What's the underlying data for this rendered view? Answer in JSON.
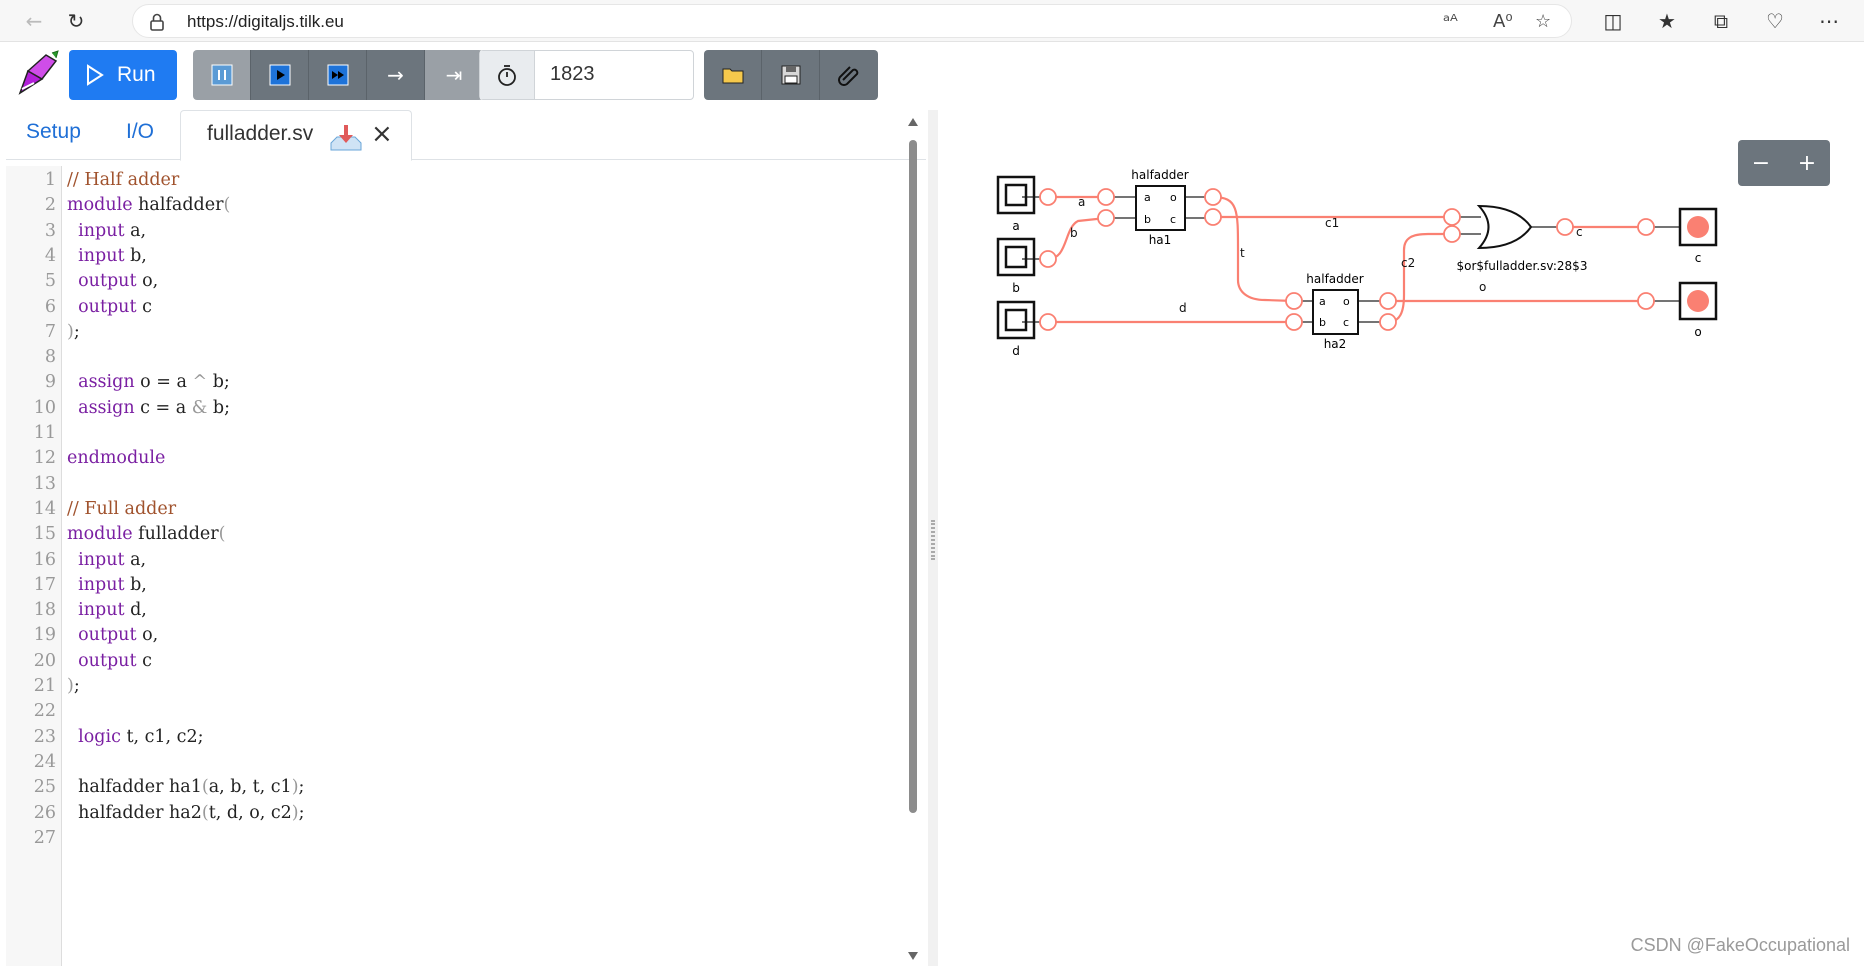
{
  "browser": {
    "url": "https://digitaljs.tilk.eu"
  },
  "toolbar": {
    "run_label": "Run",
    "tick_value": "1823"
  },
  "tabs": {
    "setup": "Setup",
    "io": "I/O",
    "file": "fulladder.sv"
  },
  "code_lines": [
    {
      "n": "1",
      "html": "<span class=\"cm\">// Half adder</span>"
    },
    {
      "n": "2",
      "html": "<span class=\"kw\">module</span> halfadder<span class=\"pn\">(</span>"
    },
    {
      "n": "3",
      "html": "  <span class=\"kw\">input</span> a,"
    },
    {
      "n": "4",
      "html": "  <span class=\"kw\">input</span> b,"
    },
    {
      "n": "5",
      "html": "  <span class=\"kw\">output</span> o,"
    },
    {
      "n": "6",
      "html": "  <span class=\"kw\">output</span> c"
    },
    {
      "n": "7",
      "html": "<span class=\"pn\">)</span>;"
    },
    {
      "n": "8",
      "html": ""
    },
    {
      "n": "9",
      "html": "  <span class=\"kw\">assign</span> o = a <span class=\"pn\">^</span> b;"
    },
    {
      "n": "10",
      "html": "  <span class=\"kw\">assign</span> c = a <span class=\"pn\">&amp;</span> b;"
    },
    {
      "n": "11",
      "html": ""
    },
    {
      "n": "12",
      "html": "<span class=\"kw\">endmodule</span>"
    },
    {
      "n": "13",
      "html": ""
    },
    {
      "n": "14",
      "html": "<span class=\"cm\">// Full adder</span>"
    },
    {
      "n": "15",
      "html": "<span class=\"kw\">module</span> fulladder<span class=\"pn\">(</span>"
    },
    {
      "n": "16",
      "html": "  <span class=\"kw\">input</span> a,"
    },
    {
      "n": "17",
      "html": "  <span class=\"kw\">input</span> b,"
    },
    {
      "n": "18",
      "html": "  <span class=\"kw\">input</span> d,"
    },
    {
      "n": "19",
      "html": "  <span class=\"kw\">output</span> o,"
    },
    {
      "n": "20",
      "html": "  <span class=\"kw\">output</span> c"
    },
    {
      "n": "21",
      "html": "<span class=\"pn\">)</span>;"
    },
    {
      "n": "22",
      "html": ""
    },
    {
      "n": "23",
      "html": "  <span class=\"kw\">logic</span> t, c1, c2;"
    },
    {
      "n": "24",
      "html": ""
    },
    {
      "n": "25",
      "html": "  halfadder ha1<span class=\"pn\">(</span>a, b, t, c1<span class=\"pn\">)</span>;"
    },
    {
      "n": "26",
      "html": "  halfadder ha2<span class=\"pn\">(</span>t, d, o, c2<span class=\"pn\">)</span>;"
    },
    {
      "n": "27",
      "html": ""
    }
  ],
  "circuit": {
    "inputs": [
      "a",
      "b",
      "d"
    ],
    "outputs": [
      "c",
      "o"
    ],
    "ha1_type": "halfadder",
    "ha1_name": "ha1",
    "ha2_type": "halfadder",
    "ha2_name": "ha2",
    "port_a": "a",
    "port_b": "b",
    "port_o": "o",
    "port_c": "c",
    "or_name": "$or$fulladder.sv:28$3",
    "wires": {
      "a": "a",
      "b": "b",
      "d": "d",
      "t": "t",
      "c1": "c1",
      "c2": "c2",
      "c": "c",
      "o": "o"
    }
  },
  "zoom": {
    "minus": "−",
    "plus": "+"
  },
  "watermark": "CSDN @FakeOccupational",
  "colors": {
    "accent": "#1f7bf2",
    "wire_high": "#fa8072",
    "button_gray": "#6c757d"
  }
}
